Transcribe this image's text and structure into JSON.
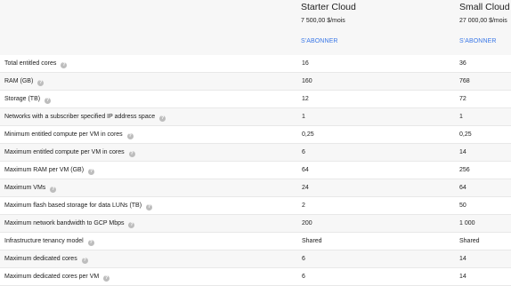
{
  "plans": [
    {
      "name": "Starter Cloud",
      "price": "7 500,00 $/mois",
      "cta": "S'ABONNER"
    },
    {
      "name": "Small Cloud",
      "price": "27 000,00 $/mois",
      "cta": "S'ABONNER"
    }
  ],
  "help_icon": "?",
  "rows": [
    {
      "label": "Total entitled cores",
      "v1": "16",
      "v2": "36"
    },
    {
      "label": "RAM (GB)",
      "v1": "160",
      "v2": "768"
    },
    {
      "label": "Storage (TB)",
      "v1": "12",
      "v2": "72"
    },
    {
      "label": "Networks with a subscriber specified IP address space",
      "v1": "1",
      "v2": "1"
    },
    {
      "label": "Minimum entitled compute per VM in cores",
      "v1": "0,25",
      "v2": "0,25"
    },
    {
      "label": "Maximum entitled compute per VM in cores",
      "v1": "6",
      "v2": "14"
    },
    {
      "label": "Maximum RAM per VM (GB)",
      "v1": "64",
      "v2": "256"
    },
    {
      "label": "Maximum VMs",
      "v1": "24",
      "v2": "64"
    },
    {
      "label": "Maximum flash based storage for data LUNs (TB)",
      "v1": "2",
      "v2": "50"
    },
    {
      "label": "Maximum network bandwidth to GCP Mbps",
      "v1": "200",
      "v2": "1 000"
    },
    {
      "label": "Infrastructure tenancy model",
      "v1": "Shared",
      "v2": "Shared"
    },
    {
      "label": "Maximum dedicated cores",
      "v1": "6",
      "v2": "14"
    },
    {
      "label": "Maximum dedicated cores per VM",
      "v1": "6",
      "v2": "14"
    }
  ],
  "colors": {
    "accent": "#3b78e7",
    "help_icon_bg": "#bdbdbd",
    "stripe": "#f7f7f7",
    "divider": "#e8e8e8"
  }
}
